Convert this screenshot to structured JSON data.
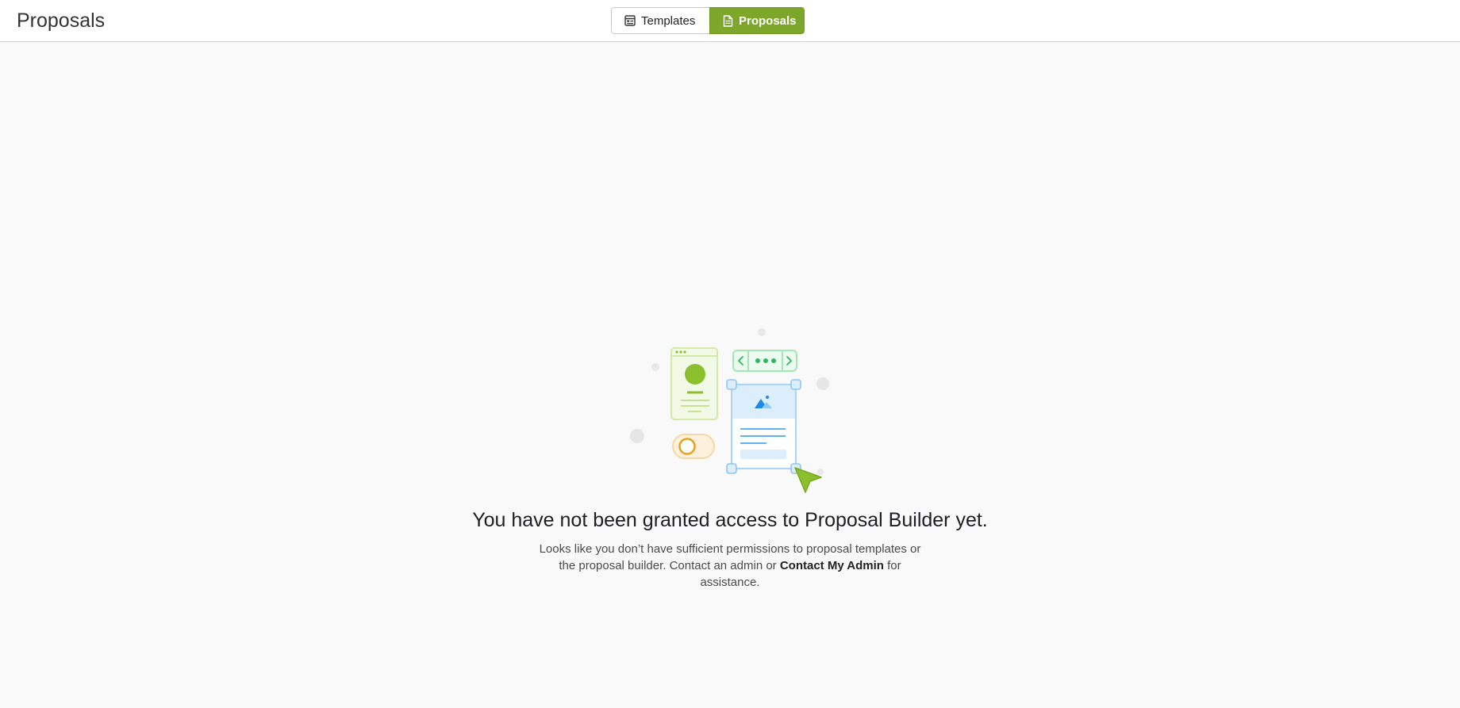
{
  "header": {
    "title": "Proposals",
    "tabs": [
      {
        "label": "Templates",
        "icon": "template-icon",
        "active": false
      },
      {
        "label": "Proposals",
        "icon": "document-icon",
        "active": true
      }
    ]
  },
  "empty_state": {
    "illustration": "proposal-builder-illustration",
    "headline": "You have not been granted access to Proposal Builder yet.",
    "desc_part1": "Looks like you don’t have sufficient permissions to proposal templates or the proposal builder. Contact an admin or ",
    "contact_link": "Contact My Admin",
    "desc_part2": " for assistance."
  },
  "colors": {
    "accent": "#7da72a",
    "background": "#f9f9f9"
  }
}
